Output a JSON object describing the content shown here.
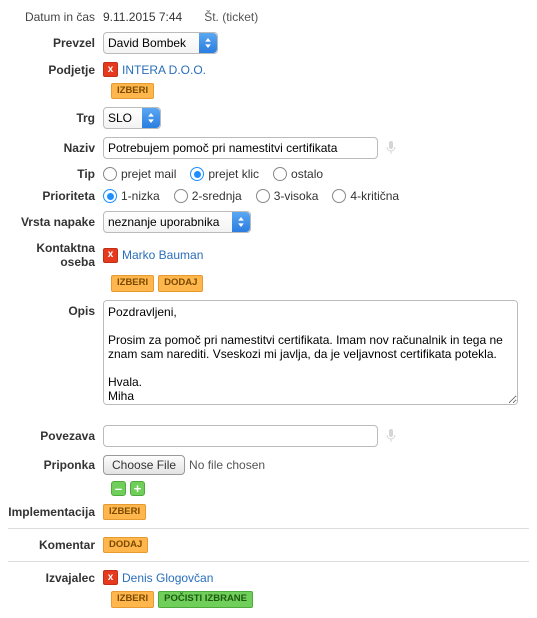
{
  "header": {
    "datetime_label": "Datum in čas",
    "datetime_value": "9.11.2015 7:44",
    "ticket_label": "Št. (ticket)"
  },
  "labels": {
    "prevzel": "Prevzel",
    "podjetje": "Podjetje",
    "trg": "Trg",
    "naziv": "Naziv",
    "tip": "Tip",
    "prioriteta": "Prioriteta",
    "vrsta_napake": "Vrsta napake",
    "kontaktna_oseba": "Kontaktna oseba",
    "opis": "Opis",
    "povezava": "Povezava",
    "priponka": "Priponka",
    "implementacija": "Implementacija",
    "komentar": "Komentar",
    "izvajalec": "Izvajalec"
  },
  "buttons": {
    "izberi": "IZBERI",
    "dodaj": "DODAJ",
    "pocisti_izbrane": "POČISTI IZBRANE",
    "choose_file": "Choose File",
    "no_file": "No file chosen"
  },
  "prevzel": {
    "value": "David Bombek"
  },
  "podjetje": {
    "value": "INTERA D.O.O."
  },
  "trg": {
    "value": "SLO"
  },
  "naziv": {
    "value": "Potrebujem pomoč pri namestitvi certifikata"
  },
  "tip": {
    "options": [
      {
        "label": "prejet mail",
        "checked": false
      },
      {
        "label": "prejet klic",
        "checked": true
      },
      {
        "label": "ostalo",
        "checked": false
      }
    ]
  },
  "prioriteta": {
    "options": [
      {
        "label": "1-nizka",
        "checked": true
      },
      {
        "label": "2-srednja",
        "checked": false
      },
      {
        "label": "3-visoka",
        "checked": false
      },
      {
        "label": "4-kritična",
        "checked": false
      }
    ]
  },
  "vrsta_napake": {
    "value": "neznanje uporabnika"
  },
  "kontaktna_oseba": {
    "value": "Marko Bauman"
  },
  "opis": {
    "value": "Pozdravljeni,\n\nProsim za pomoč pri namestitvi certifikata. Imam nov računalnik in tega ne znam sam narediti. Vseskozi mi javlja, da je veljavnost certifikata potekla.\n\nHvala.\nMiha"
  },
  "povezava": {
    "value": ""
  },
  "izvajalec": {
    "value": "Denis Glogovčan"
  },
  "icons": {
    "x": "x",
    "minus": "–",
    "plus": "+"
  }
}
